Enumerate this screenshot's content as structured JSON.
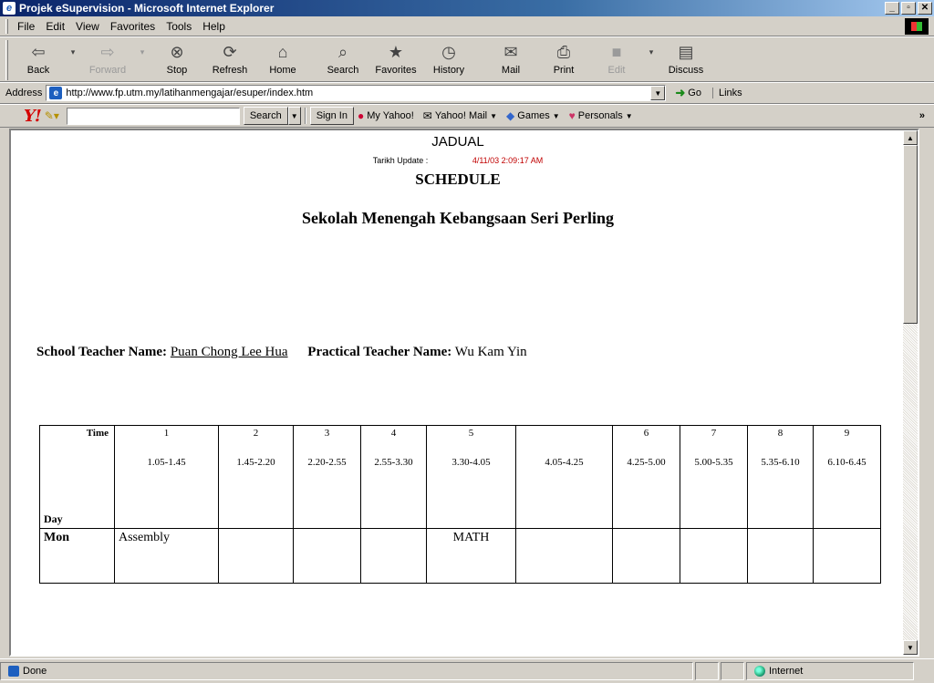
{
  "window": {
    "title": "Projek eSupervision - Microsoft Internet Explorer"
  },
  "menu": [
    "File",
    "Edit",
    "View",
    "Favorites",
    "Tools",
    "Help"
  ],
  "toolbar": {
    "back": "Back",
    "forward": "Forward",
    "stop": "Stop",
    "refresh": "Refresh",
    "home": "Home",
    "search": "Search",
    "favorites": "Favorites",
    "history": "History",
    "mail": "Mail",
    "print": "Print",
    "edit": "Edit",
    "discuss": "Discuss"
  },
  "address": {
    "label": "Address",
    "url": "http://www.fp.utm.my/latihanmengajar/esuper/index.htm",
    "go": "Go",
    "links": "Links"
  },
  "yahoo": {
    "logo": "Y!",
    "search_value": "",
    "search_button": "Search",
    "signin": "Sign In",
    "my_yahoo": "My Yahoo!",
    "mail": "Yahoo! Mail",
    "games": "Games",
    "personals": "Personals"
  },
  "page": {
    "heading": "JADUAL",
    "update_label": "Tarikh Update :",
    "update_value": "4/11/03 2:09:17 AM",
    "schedule": "SCHEDULE",
    "school": "Sekolah Menengah Kebangsaan Seri Perling",
    "school_teacher_label": "School Teacher Name:",
    "school_teacher": "Puan Chong Lee Hua",
    "practical_teacher_label": "Practical Teacher Name:",
    "practical_teacher": "Wu Kam Yin"
  },
  "table": {
    "time_label": "Time",
    "day_label": "Day",
    "slots": [
      {
        "num": "1",
        "time": "1.05-1.45"
      },
      {
        "num": "2",
        "time": "1.45-2.20"
      },
      {
        "num": "3",
        "time": "2.20-2.55"
      },
      {
        "num": "4",
        "time": "2.55-3.30"
      },
      {
        "num": "5",
        "time": "3.30-4.05"
      },
      {
        "num": "",
        "time": "4.05-4.25"
      },
      {
        "num": "6",
        "time": "4.25-5.00"
      },
      {
        "num": "7",
        "time": "5.00-5.35"
      },
      {
        "num": "8",
        "time": "5.35-6.10"
      },
      {
        "num": "9",
        "time": "6.10-6.45"
      }
    ],
    "rows": [
      {
        "day": "Mon",
        "cells": [
          "Assembly",
          "",
          "",
          "",
          "MATH",
          "",
          "",
          "",
          "",
          ""
        ]
      }
    ]
  },
  "status": {
    "text": "Done",
    "zone": "Internet"
  }
}
